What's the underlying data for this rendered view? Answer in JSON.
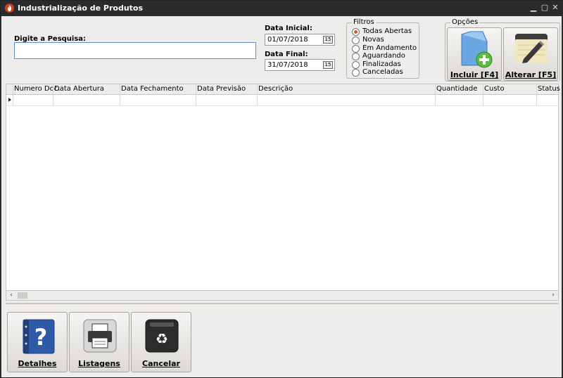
{
  "window": {
    "title": "Industrialização de Produtos"
  },
  "search": {
    "label": "Digite a Pesquisa:",
    "value": "",
    "placeholder": ""
  },
  "dates": {
    "start_label": "Data Inicial:",
    "start_value": "01/07/2018",
    "end_label": "Data Final:",
    "end_value": "31/07/2018",
    "calendar_glyph": "15"
  },
  "filters": {
    "legend": "Filtros",
    "options": [
      "Todas Abertas",
      "Novas",
      "Em Andamento",
      "Aguardando",
      "Finalizadas",
      "Canceladas"
    ],
    "selected": "Todas Abertas"
  },
  "options": {
    "legend": "Opções",
    "include_label": "Incluir [F4]",
    "edit_label": "Alterar [F5]"
  },
  "grid": {
    "columns": [
      "Numero Doc.",
      "Data Abertura",
      "Data Fechamento",
      "Data Previsão",
      "Descrição",
      "Quantidade",
      "Custo",
      "Status"
    ]
  },
  "footer": {
    "details_label": "Detalhes",
    "listings_label": "Listagens",
    "cancel_label": "Cancelar"
  },
  "colors": {
    "title_bar": "#2b2b2b",
    "accent_radio": "#e05a28",
    "focus_border": "#5c8fc7",
    "background": "#efedeb"
  },
  "icons": {
    "app": "flame-icon",
    "include": "add-document-icon",
    "edit": "notepad-pencil-icon",
    "details": "help-book-icon",
    "listings": "printer-icon",
    "cancel": "recycle-bin-icon"
  }
}
